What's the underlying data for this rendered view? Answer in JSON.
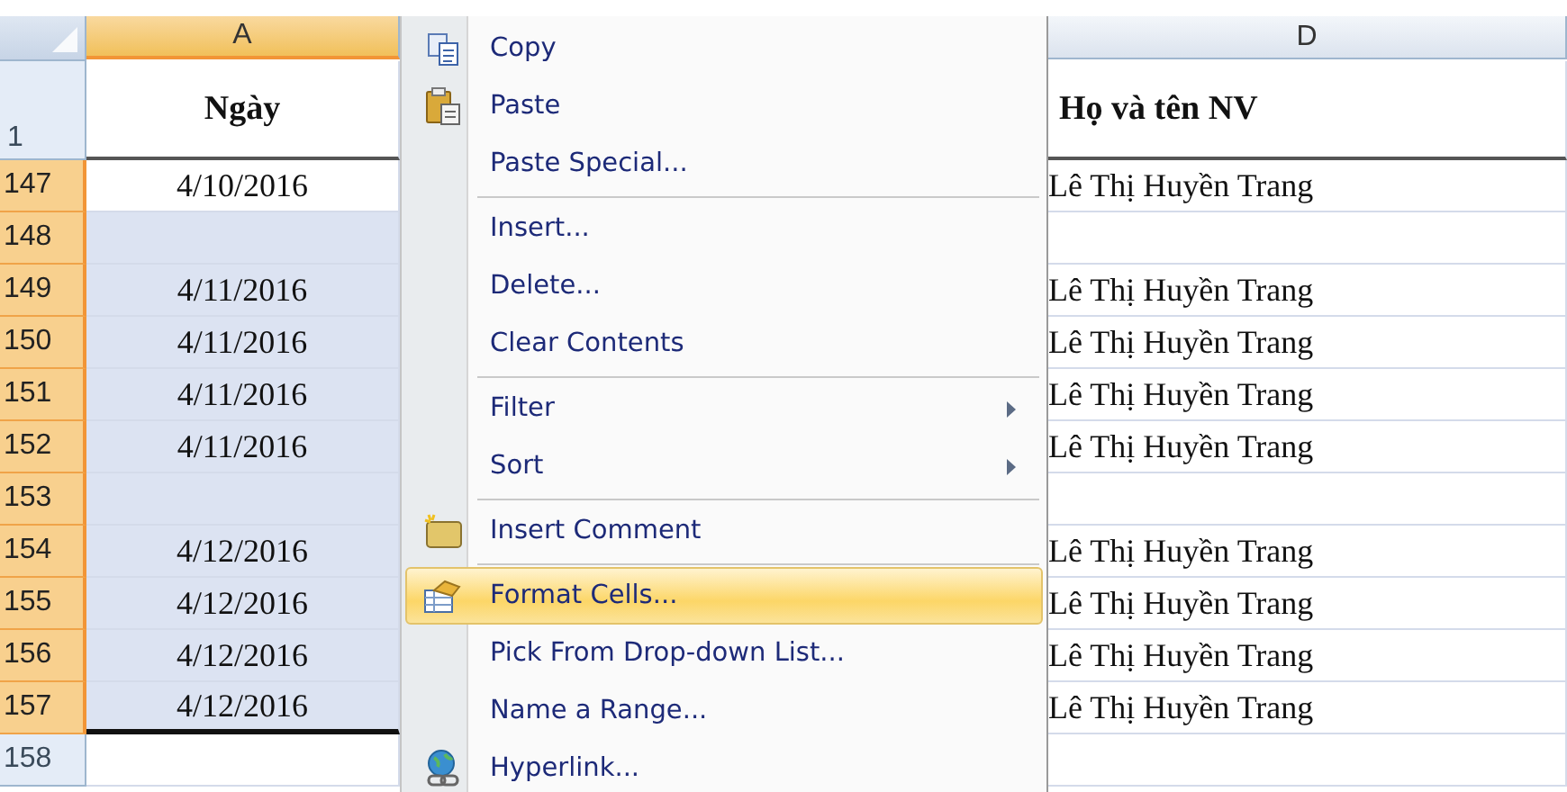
{
  "sheet": {
    "columns": [
      {
        "label": "A",
        "selected": true
      },
      {
        "label": "D",
        "selected": false
      }
    ],
    "header_row": {
      "row": "1",
      "cells": [
        "Ngày",
        "Họ và tên NV"
      ]
    },
    "rows": [
      {
        "row": "147",
        "selected": true,
        "a": {
          "text": "4/10/2016",
          "selected": false
        },
        "d": {
          "text": "Lê Thị Huyền Trang"
        }
      },
      {
        "row": "148",
        "selected": true,
        "a": {
          "selected": true
        },
        "d": {}
      },
      {
        "row": "149",
        "selected": true,
        "a": {
          "text": "4/11/2016",
          "selected": true
        },
        "d": {
          "text": "Lê Thị Huyền Trang"
        }
      },
      {
        "row": "150",
        "selected": true,
        "a": {
          "text": "4/11/2016",
          "selected": true
        },
        "d": {
          "text": "Lê Thị Huyền Trang"
        }
      },
      {
        "row": "151",
        "selected": true,
        "a": {
          "text": "4/11/2016",
          "selected": true
        },
        "d": {
          "text": "Lê Thị Huyền Trang"
        }
      },
      {
        "row": "152",
        "selected": true,
        "a": {
          "text": "4/11/2016",
          "selected": true
        },
        "d": {
          "text": "Lê Thị Huyền Trang"
        }
      },
      {
        "row": "153",
        "selected": true,
        "a": {
          "selected": true
        },
        "d": {}
      },
      {
        "row": "154",
        "selected": true,
        "a": {
          "text": "4/12/2016",
          "selected": true
        },
        "d": {
          "text": "Lê Thị Huyền Trang"
        }
      },
      {
        "row": "155",
        "selected": true,
        "a": {
          "text": "4/12/2016",
          "selected": true
        },
        "d": {
          "text": "Lê Thị Huyền Trang"
        }
      },
      {
        "row": "156",
        "selected": true,
        "a": {
          "text": "4/12/2016",
          "selected": true
        },
        "d": {
          "text": "Lê Thị Huyền Trang"
        }
      },
      {
        "row": "157",
        "selected": true,
        "a": {
          "text": "4/12/2016",
          "selected": true
        },
        "d": {
          "text": "Lê Thị Huyền Trang"
        }
      },
      {
        "row": "158",
        "selected": false,
        "a": {
          "selected": false
        },
        "d": {}
      }
    ]
  },
  "context_menu": {
    "items": [
      {
        "kind": "item",
        "label": "Copy",
        "selected": false,
        "submenu": false
      },
      {
        "kind": "item",
        "label": "Paste",
        "selected": false,
        "submenu": false
      },
      {
        "kind": "item",
        "label": "Paste Special...",
        "selected": false,
        "submenu": false
      },
      {
        "kind": "separator"
      },
      {
        "kind": "item",
        "label": "Insert...",
        "selected": false,
        "submenu": false
      },
      {
        "kind": "item",
        "label": "Delete...",
        "selected": false,
        "submenu": false
      },
      {
        "kind": "item",
        "label": "Clear Contents",
        "selected": false,
        "submenu": false
      },
      {
        "kind": "separator"
      },
      {
        "kind": "item",
        "label": "Filter",
        "selected": false,
        "submenu": true
      },
      {
        "kind": "item",
        "label": "Sort",
        "selected": false,
        "submenu": true
      },
      {
        "kind": "separator"
      },
      {
        "kind": "item",
        "label": "Insert Comment",
        "selected": false,
        "submenu": false
      },
      {
        "kind": "separator"
      },
      {
        "kind": "item",
        "label": "Format Cells...",
        "selected": true,
        "submenu": false
      },
      {
        "kind": "item",
        "label": "Pick From Drop-down List...",
        "selected": false,
        "submenu": false
      },
      {
        "kind": "item",
        "label": "Name a Range...",
        "selected": false,
        "submenu": false
      },
      {
        "kind": "item",
        "label": "Hyperlink...",
        "selected": false,
        "submenu": false
      }
    ]
  }
}
